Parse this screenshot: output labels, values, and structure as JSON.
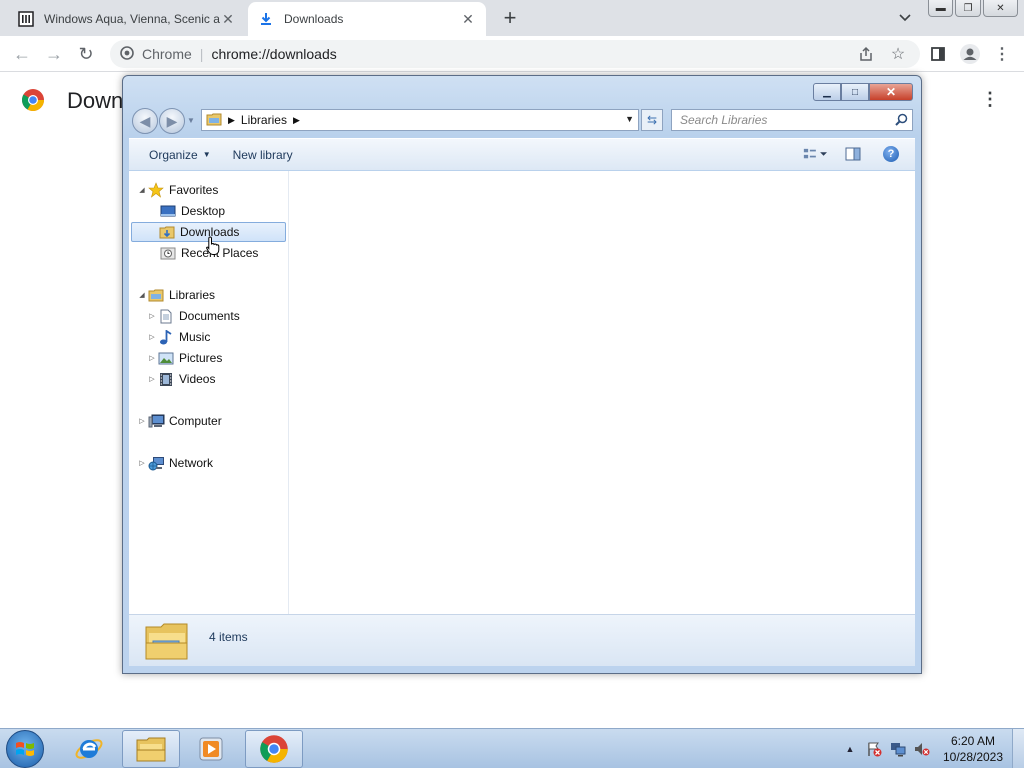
{
  "browser": {
    "tabs": [
      {
        "title": "Windows Aqua, Vienna, Scenic an",
        "icon": "museum-icon",
        "active": false
      },
      {
        "title": "Downloads",
        "icon": "download-icon",
        "active": true
      }
    ],
    "newtab_label": "+",
    "omnibox": {
      "origin": "Chrome",
      "separator": "|",
      "url": "chrome://downloads"
    }
  },
  "downloads_page": {
    "title": "Downloads"
  },
  "explorer": {
    "address": {
      "breadcrumbs": [
        "Libraries"
      ]
    },
    "search": {
      "placeholder": "Search Libraries"
    },
    "commands": {
      "organize": "Organize",
      "new_library": "New library"
    },
    "nav": {
      "favorites": {
        "label": "Favorites",
        "items": [
          "Desktop",
          "Downloads",
          "Recent Places"
        ]
      },
      "libraries": {
        "label": "Libraries",
        "items": [
          "Documents",
          "Music",
          "Pictures",
          "Videos"
        ]
      },
      "computer": "Computer",
      "network": "Network"
    },
    "selected_item": "Downloads",
    "details": {
      "count": "4 items"
    }
  },
  "taskbar": {
    "clock_time": "6:20 AM",
    "clock_date": "10/28/2023"
  }
}
